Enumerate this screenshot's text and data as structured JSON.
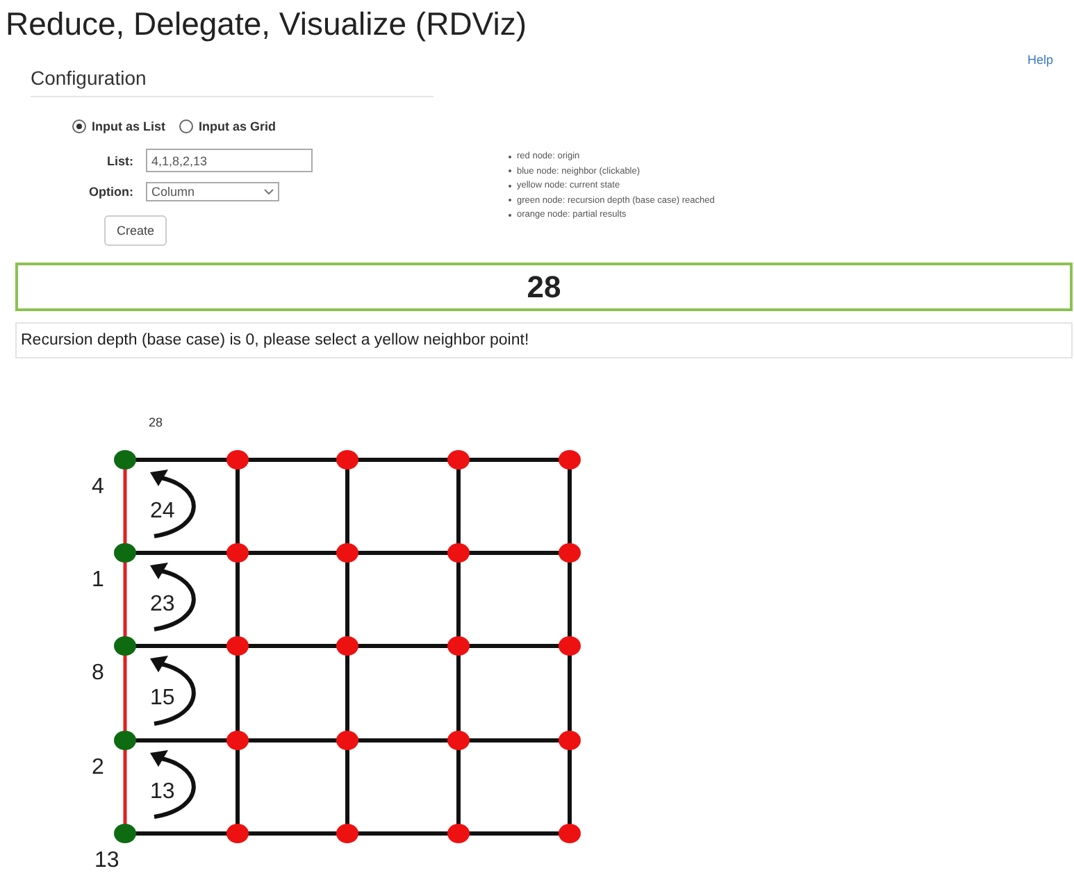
{
  "title": "Reduce, Delegate, Visualize (RDViz)",
  "help_link": "Help",
  "configuration": {
    "heading": "Configuration",
    "input_modes": [
      {
        "label": "Input as List",
        "selected": true
      },
      {
        "label": "Input as Grid",
        "selected": false
      }
    ],
    "list_label": "List:",
    "list_value": "4,1,8,2,13",
    "option_label": "Option:",
    "option_value": "Column",
    "create_button": "Create"
  },
  "legend": [
    "red node: origin",
    "blue node: neighbor (clickable)",
    "yellow node: current state",
    "green node: recursion depth (base case) reached",
    "orange node: partial results"
  ],
  "result": "28",
  "message": "Recursion depth (base case) is 0, please select a yellow neighbor point!",
  "diagram": {
    "top_label": "28",
    "bottom_label": "13",
    "segments": [
      {
        "label": "4",
        "arrow_value": "24"
      },
      {
        "label": "1",
        "arrow_value": "23"
      },
      {
        "label": "8",
        "arrow_value": "15"
      },
      {
        "label": "2",
        "arrow_value": "13"
      }
    ],
    "node_rows": [
      {
        "nodes": [
          {
            "color": "#0f6b12"
          },
          {
            "color": "#ee1111"
          },
          {
            "color": "#ee1111"
          },
          {
            "color": "#ee1111"
          },
          {
            "color": "#ee1111"
          }
        ]
      },
      {
        "nodes": [
          {
            "color": "#0f6b12"
          },
          {
            "color": "#ee1111"
          },
          {
            "color": "#ee1111"
          },
          {
            "color": "#ee1111"
          },
          {
            "color": "#ee1111"
          }
        ]
      },
      {
        "nodes": [
          {
            "color": "#0f6b12"
          },
          {
            "color": "#ee1111"
          },
          {
            "color": "#ee1111"
          },
          {
            "color": "#ee1111"
          },
          {
            "color": "#ee1111"
          }
        ]
      },
      {
        "nodes": [
          {
            "color": "#0f6b12"
          },
          {
            "color": "#ee1111"
          },
          {
            "color": "#ee1111"
          },
          {
            "color": "#ee1111"
          },
          {
            "color": "#ee1111"
          }
        ]
      },
      {
        "nodes": [
          {
            "color": "#0f6b12"
          },
          {
            "color": "#ee1111"
          },
          {
            "color": "#ee1111"
          },
          {
            "color": "#ee1111"
          },
          {
            "color": "#ee1111"
          }
        ]
      }
    ]
  }
}
